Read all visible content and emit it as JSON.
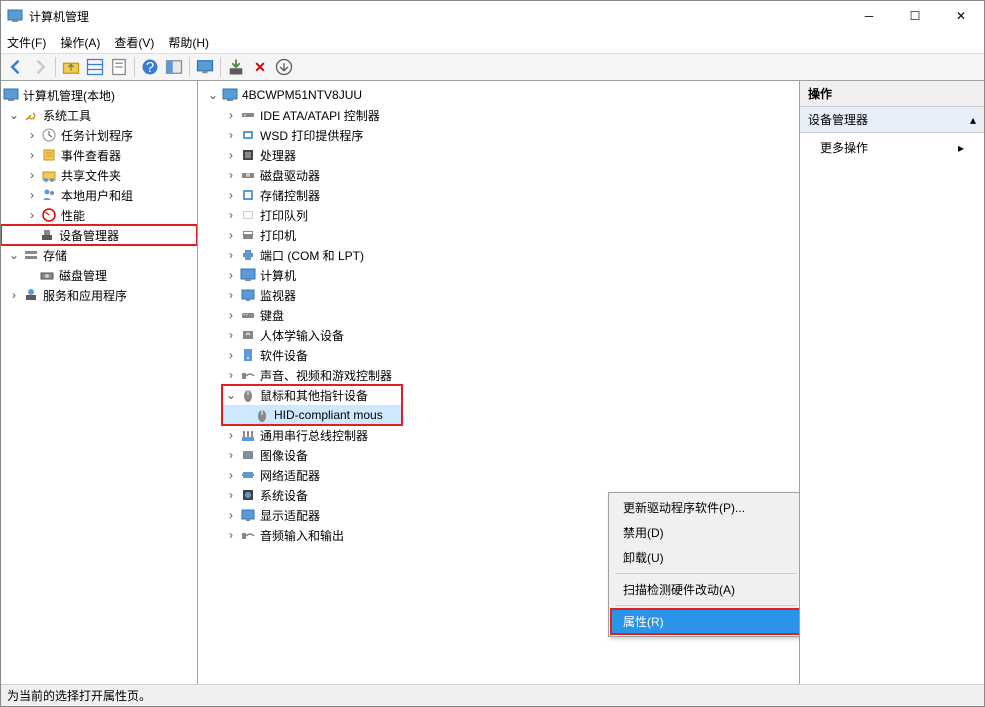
{
  "window": {
    "title": "计算机管理"
  },
  "menubar": [
    "文件(F)",
    "操作(A)",
    "查看(V)",
    "帮助(H)"
  ],
  "left_tree": {
    "root": "计算机管理(本地)",
    "sys_tools": "系统工具",
    "items_sys": [
      "任务计划程序",
      "事件查看器",
      "共享文件夹",
      "本地用户和组",
      "性能"
    ],
    "dev_mgr": "设备管理器",
    "storage": "存储",
    "disk_mgmt": "磁盘管理",
    "svc_apps": "服务和应用程序"
  },
  "mid_tree": {
    "computer": "4BCWPM51NTV8JUU",
    "cats": [
      "IDE ATA/ATAPI 控制器",
      "WSD 打印提供程序",
      "处理器",
      "磁盘驱动器",
      "存储控制器",
      "打印队列",
      "打印机",
      "端口 (COM 和 LPT)",
      "计算机",
      "监视器",
      "键盘",
      "人体学输入设备",
      "软件设备",
      "声音、视频和游戏控制器"
    ],
    "mouse_cat": "鼠标和其他指针设备",
    "mouse_item": "HID-compliant mous",
    "cats2": [
      "通用串行总线控制器",
      "图像设备",
      "网络适配器",
      "系统设备",
      "显示适配器",
      "音频输入和输出"
    ]
  },
  "ctx": {
    "update": "更新驱动程序软件(P)...",
    "disable": "禁用(D)",
    "uninstall": "卸载(U)",
    "scan": "扫描检测硬件改动(A)",
    "props": "属性(R)"
  },
  "right": {
    "header": "操作",
    "sub": "设备管理器",
    "item": "更多操作"
  },
  "status": "为当前的选择打开属性页。"
}
